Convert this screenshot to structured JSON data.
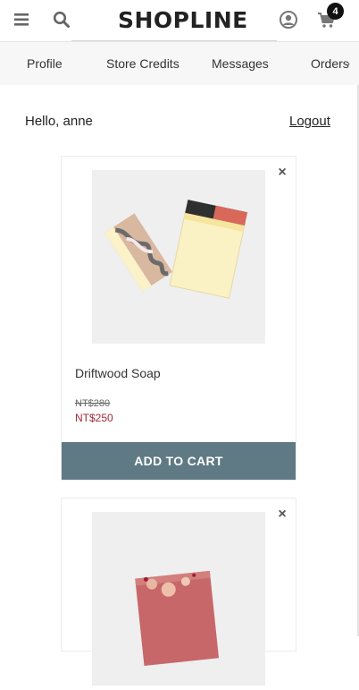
{
  "header": {
    "logo": "SHOPLINE",
    "cart_count": "4",
    "icons": [
      "menu-icon",
      "search-icon",
      "user-icon",
      "cart-icon"
    ]
  },
  "tabs": [
    "Profile",
    "Store Credits",
    "Messages",
    "Orders"
  ],
  "greeting": "Hello, anne",
  "logout_label": "Logout",
  "products": [
    {
      "name": "Driftwood Soap",
      "original_price": "NT$280",
      "sale_price": "NT$250",
      "button_label": "ADD TO CART"
    },
    {
      "name": "",
      "original_price": "",
      "sale_price": "",
      "button_label": ""
    }
  ],
  "colors": {
    "button": "#5f7a84",
    "sale_price": "#a0283c",
    "tab_background": "#f7f7f7"
  }
}
